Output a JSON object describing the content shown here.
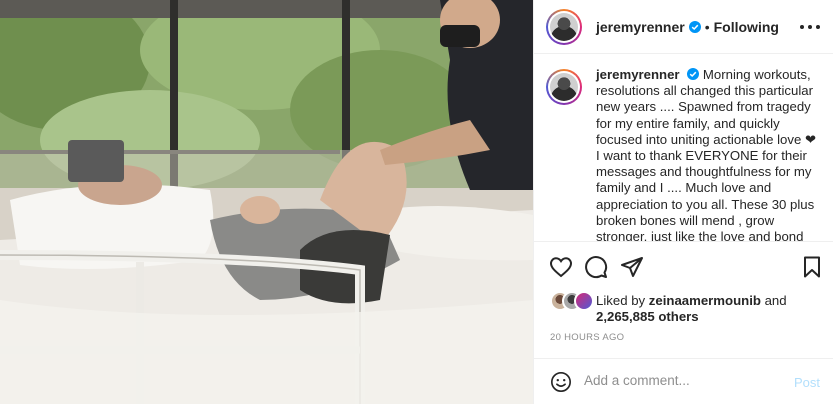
{
  "post": {
    "author": "jeremyrenner",
    "follow_status": "Following",
    "caption_user": "jeremyrenner",
    "caption_text": "Morning workouts, resolutions all changed this particular new years .... Spawned from tragedy for my entire family, and quickly focused into uniting actionable love ❤ I want to thank EVERYONE for their messages and thoughtfulness for my family and I .... Much love and appreciation to you all. These 30 plus broken bones will mend , grow stronger, just like the love and bond",
    "liked_by_prefix": "Liked by",
    "liked_by_user": "zeinaamermounib",
    "liked_by_and": "and",
    "likes_others": "2,265,885 others",
    "timestamp": "20 HOURS AGO"
  },
  "comment": {
    "placeholder": "Add a comment...",
    "post_label": "Post"
  },
  "icons": {
    "verified": "verified-badge-icon",
    "more": "more-options-icon",
    "like": "heart-icon",
    "comment": "comment-icon",
    "share": "share-icon",
    "save": "bookmark-icon",
    "emoji": "emoji-icon"
  },
  "colors": {
    "verified": "#0095f6",
    "post_disabled": "#b2dffc",
    "muted": "#8e8e8e",
    "text": "#262626",
    "divider": "#efefef"
  }
}
